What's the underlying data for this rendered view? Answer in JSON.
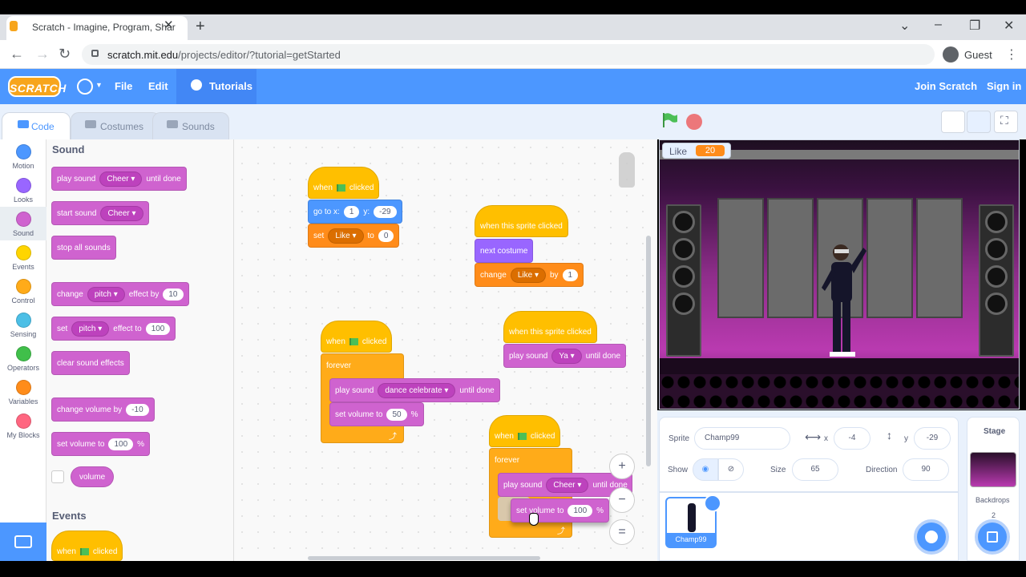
{
  "browser": {
    "tab_title": "Scratch - Imagine, Program, Shar",
    "url_host": "scratch.mit.edu",
    "url_path": "/projects/editor/?tutorial=getStarted",
    "profile": "Guest"
  },
  "menubar": {
    "logo": "SCRATCH",
    "file": "File",
    "edit": "Edit",
    "tutorials": "Tutorials",
    "join": "Join Scratch",
    "signin": "Sign in"
  },
  "tabs": {
    "code": "Code",
    "costumes": "Costumes",
    "sounds": "Sounds"
  },
  "categories": [
    {
      "label": "Motion",
      "color": "#4c97ff"
    },
    {
      "label": "Looks",
      "color": "#9966ff"
    },
    {
      "label": "Sound",
      "color": "#cf63cf"
    },
    {
      "label": "Events",
      "color": "#ffd500"
    },
    {
      "label": "Control",
      "color": "#ffab19"
    },
    {
      "label": "Sensing",
      "color": "#4cbfe6"
    },
    {
      "label": "Operators",
      "color": "#40bf4a"
    },
    {
      "label": "Variables",
      "color": "#ff8c1a"
    },
    {
      "label": "My Blocks",
      "color": "#ff6680"
    }
  ],
  "palette": {
    "sound_header": "Sound",
    "events_header": "Events",
    "play_sound": "play sound",
    "until_done": "until done",
    "start_sound": "start sound",
    "cheer": "Cheer",
    "stop_all": "stop all sounds",
    "change": "change",
    "set": "set",
    "pitch": "pitch",
    "effect_by": "effect by",
    "effect_to": "effect to",
    "val_10": "10",
    "val_100": "100",
    "clear_effects": "clear sound effects",
    "change_volume_by": "change volume by",
    "val_neg10": "-10",
    "set_volume_to": "set volume to",
    "percent": "%",
    "volume": "volume",
    "when": "when",
    "clicked": "clicked"
  },
  "scripts": {
    "when": "when",
    "clicked": "clicked",
    "go_to_x": "go to x:",
    "y": "y:",
    "x_val": "1",
    "y_val": "-29",
    "set": "set",
    "like": "Like",
    "to": "to",
    "zero": "0",
    "when_sprite_clicked": "when this sprite clicked",
    "next_costume": "next costume",
    "change": "change",
    "by": "by",
    "one": "1",
    "forever": "forever",
    "play_sound": "play sound",
    "dance_celebrate": "dance celebrate",
    "until_done": "until done",
    "set_volume_to": "set volume to",
    "vol_50": "50",
    "percent": "%",
    "ya": "Ya",
    "cheer": "Cheer",
    "vol_100": "100",
    "zoom_in": "+",
    "zoom_out": "−",
    "zoom_reset": "="
  },
  "stage": {
    "monitor_label": "Like",
    "monitor_value": "20"
  },
  "sprite_info": {
    "sprite_label": "Sprite",
    "sprite_name": "Champ99",
    "x_label": "x",
    "x_val": "-4",
    "y_label": "y",
    "y_val": "-29",
    "show_label": "Show",
    "size_label": "Size",
    "size_val": "65",
    "direction_label": "Direction",
    "direction_val": "90",
    "thumb_name": "Champ99"
  },
  "stage_panel": {
    "title": "Stage",
    "backdrops_label": "Backdrops",
    "backdrops_count": "2"
  }
}
